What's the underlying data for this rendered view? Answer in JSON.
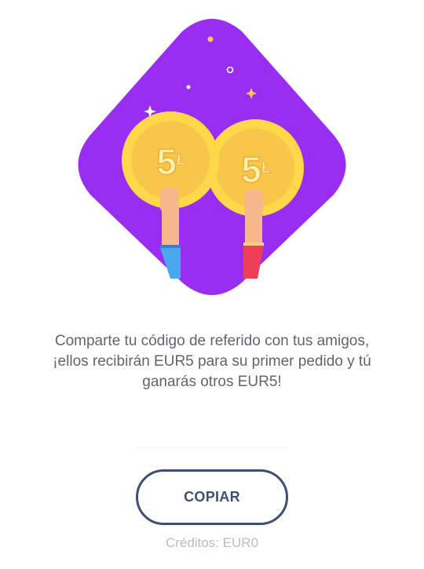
{
  "illustration": {
    "coin_left_label": "5",
    "coin_left_symbol": "Ł",
    "coin_right_label": "5",
    "coin_right_symbol": "Ł",
    "colors": {
      "background": "#9a2df2",
      "coin_outer": "#ffd84a",
      "coin_inner": "#f7c64a",
      "coin_text": "#fff3b0",
      "sleeve_left": "#4aa8ee",
      "sleeve_right": "#ee3e5a",
      "skin": "#f7b78d"
    }
  },
  "referral": {
    "line1": "Comparte tu código de referido con tus amigos,",
    "line2": "¡ellos recibirán EUR5 para su primer pedido y tú",
    "line3": "ganarás otros EUR5!"
  },
  "actions": {
    "copy_label": "COPIAR"
  },
  "credits": {
    "label": "Créditos: EUR0"
  }
}
